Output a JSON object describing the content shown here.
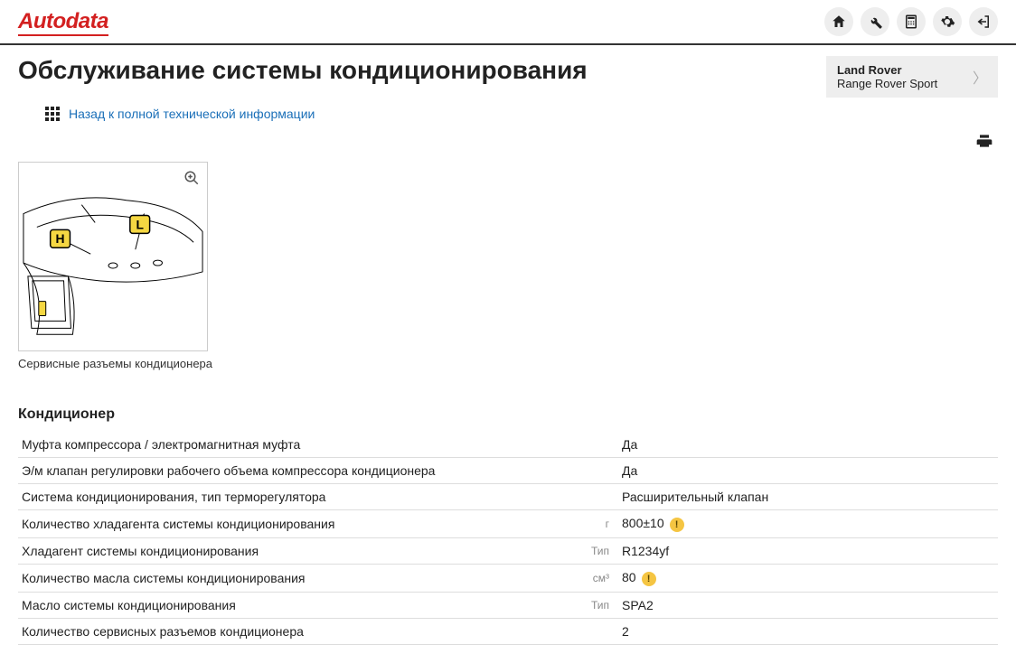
{
  "brand": "Autodata",
  "page_title": "Обслуживание системы кондиционирования",
  "back_link": "Назад к полной технической информации",
  "vehicle": {
    "make": "Land Rover",
    "model": "Range Rover Sport"
  },
  "diagram": {
    "caption": "Сервисные разъемы кондиционера",
    "labels": {
      "high": "H",
      "low": "L"
    }
  },
  "section_title": "Кондиционер",
  "specs": [
    {
      "label": "Муфта компрессора / электромагнитная муфта",
      "unit": "",
      "value": "Да",
      "warn": false
    },
    {
      "label": "Э/м клапан регулировки рабочего объема компрессора кондиционера",
      "unit": "",
      "value": "Да",
      "warn": false
    },
    {
      "label": "Система кондиционирования, тип терморегулятора",
      "unit": "",
      "value": "Расширительный клапан",
      "warn": false
    },
    {
      "label": "Количество хладагента системы кондиционирования",
      "unit": "г",
      "value": "800±10",
      "warn": true
    },
    {
      "label": "Хладагент системы кондиционирования",
      "unit": "Тип",
      "value": "R1234yf",
      "warn": false
    },
    {
      "label": "Количество масла системы кондиционирования",
      "unit": "см³",
      "value": "80",
      "warn": true
    },
    {
      "label": "Масло системы кондиционирования",
      "unit": "Тип",
      "value": "SPA2",
      "warn": false
    },
    {
      "label": "Количество сервисных разъемов кондиционера",
      "unit": "",
      "value": "2",
      "warn": false
    }
  ],
  "warn_mark": "!"
}
